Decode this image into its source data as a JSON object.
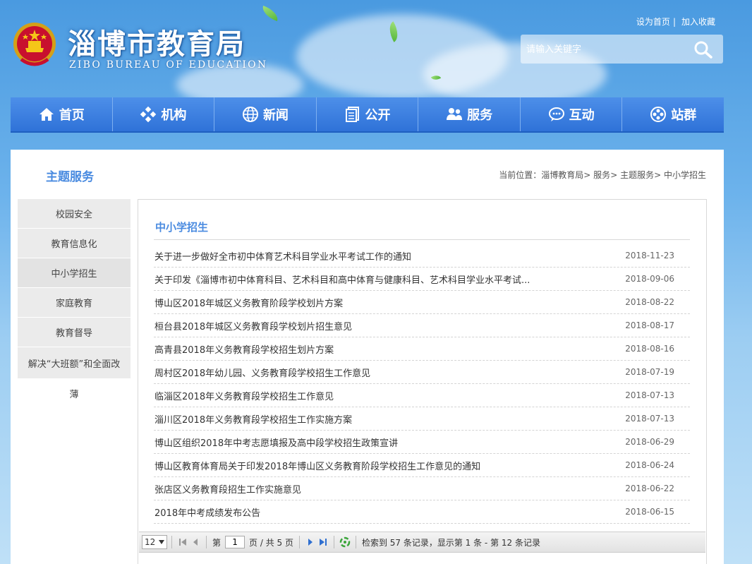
{
  "header": {
    "site_title": "淄博市教育局",
    "site_subtitle": "ZIBO BUREAU OF EDUCATION",
    "set_home": "设为首页",
    "add_favorite": "加入收藏",
    "search_placeholder": "请输入关键字"
  },
  "nav": {
    "items": [
      {
        "label": "首页",
        "icon": "home-icon"
      },
      {
        "label": "机构",
        "icon": "org-icon"
      },
      {
        "label": "新闻",
        "icon": "globe-icon"
      },
      {
        "label": "公开",
        "icon": "document-icon"
      },
      {
        "label": "服务",
        "icon": "users-icon"
      },
      {
        "label": "互动",
        "icon": "chat-icon"
      },
      {
        "label": "站群",
        "icon": "cluster-icon"
      }
    ]
  },
  "section": {
    "title": "主题服务"
  },
  "breadcrumb": {
    "prefix": "当前位置：",
    "items": [
      "淄博教育局",
      "服务",
      "主题服务",
      "中小学招生"
    ],
    "sep": ">"
  },
  "sidebar": {
    "items": [
      {
        "label": "校园安全"
      },
      {
        "label": "教育信息化"
      },
      {
        "label": "中小学招生"
      },
      {
        "label": "家庭教育"
      },
      {
        "label": "教育督导"
      },
      {
        "label": "解决“大班额”和全面改",
        "label2": "薄"
      }
    ]
  },
  "content": {
    "title": "中小学招生",
    "rows": [
      {
        "title": "关于进一步做好全市初中体育艺术科目学业水平考试工作的通知",
        "date": "2018-11-23"
      },
      {
        "title": "关于印发《淄博市初中体育科目、艺术科目和高中体育与健康科目、艺术科目学业水平考试...",
        "date": "2018-09-06"
      },
      {
        "title": "博山区2018年城区义务教育阶段学校划片方案",
        "date": "2018-08-22"
      },
      {
        "title": "桓台县2018年城区义务教育段学校划片招生意见",
        "date": "2018-08-17"
      },
      {
        "title": "高青县2018年义务教育段学校招生划片方案",
        "date": "2018-08-16"
      },
      {
        "title": "周村区2018年幼儿园、义务教育段学校招生工作意见",
        "date": "2018-07-19"
      },
      {
        "title": "临淄区2018年义务教育段学校招生工作意见",
        "date": "2018-07-13"
      },
      {
        "title": "淄川区2018年义务教育段学校招生工作实施方案",
        "date": "2018-07-13"
      },
      {
        "title": "博山区组织2018年中考志愿填报及高中段学校招生政策宣讲",
        "date": "2018-06-29"
      },
      {
        "title": "博山区教育体育局关于印发2018年博山区义务教育阶段学校招生工作意见的通知",
        "date": "2018-06-24"
      },
      {
        "title": "张店区义务教育段招生工作实施意见",
        "date": "2018-06-22"
      },
      {
        "title": "2018年中考成绩发布公告",
        "date": "2018-06-15"
      }
    ]
  },
  "pager": {
    "page_size": "12",
    "page_label_before": "第",
    "current_page": "1",
    "page_label_after": "页 / 共 5 页",
    "summary": "检索到 57 条记录，显示第 1 条 - 第 12 条记录"
  },
  "colors": {
    "accent": "#4a8be0",
    "nav_bg": "#3a7fe0"
  }
}
